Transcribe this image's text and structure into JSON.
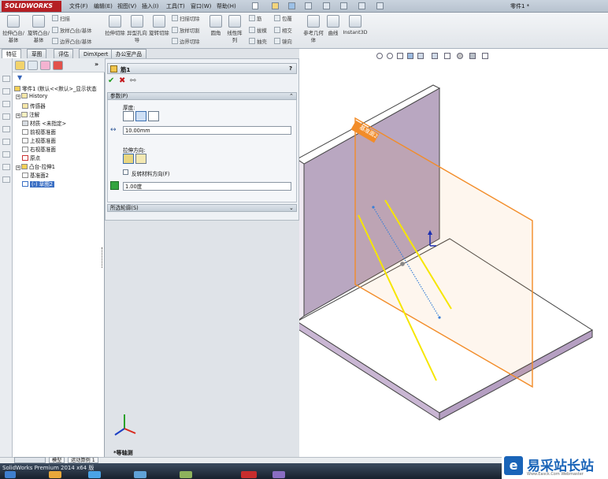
{
  "app": {
    "logo_text": "SOLIDWORKS",
    "doc_title": "零件1 *",
    "menus": [
      "文件(F)",
      "编辑(E)",
      "视图(V)",
      "插入(I)",
      "工具(T)",
      "窗口(W)",
      "帮助(H)"
    ]
  },
  "ribbon": {
    "buttons_large": [
      {
        "label": "拉伸凸台/基体",
        "icon": "extrude-boss-icon"
      },
      {
        "label": "旋转凸台/基体",
        "icon": "revolve-boss-icon"
      },
      {
        "label": "拉伸切除",
        "icon": "extrude-cut-icon"
      },
      {
        "label": "异型孔向导",
        "icon": "hole-wizard-icon"
      },
      {
        "label": "旋转切除",
        "icon": "revolve-cut-icon"
      },
      {
        "label": "圆角",
        "icon": "fillet-icon"
      },
      {
        "label": "线性阵列",
        "icon": "linear-pattern-icon"
      },
      {
        "label": "参考几何体",
        "icon": "reference-geometry-icon"
      },
      {
        "label": "曲线",
        "icon": "curves-icon"
      },
      {
        "label": "Instant3D",
        "icon": "instant3d-icon"
      }
    ],
    "buttons_small": [
      "扫描",
      "放样凸台/基体",
      "边界凸台/基体",
      "扫描切除",
      "放样切割",
      "边界切除",
      "筋",
      "拔模",
      "抽壳",
      "包覆",
      "相交",
      "镜向"
    ]
  },
  "tabs": [
    "特征",
    "草图",
    "评估",
    "DimXpert",
    "办公室产品"
  ],
  "tree": {
    "root": "零件1 (默认<<默认>_显示状态",
    "items": [
      {
        "label": "History",
        "icon": "history-icon",
        "expandable": true
      },
      {
        "label": "传感器",
        "icon": "sensor-icon",
        "expandable": false
      },
      {
        "label": "注解",
        "icon": "annotation-icon",
        "expandable": true
      },
      {
        "label": "材质 <未指定>",
        "icon": "material-icon",
        "expandable": false
      },
      {
        "label": "前视基准面",
        "icon": "plane-icon",
        "expandable": false
      },
      {
        "label": "上视基准面",
        "icon": "plane-icon",
        "expandable": false
      },
      {
        "label": "右视基准面",
        "icon": "plane-icon",
        "expandable": false
      },
      {
        "label": "原点",
        "icon": "origin-icon",
        "expandable": false
      },
      {
        "label": "凸台-拉伸1",
        "icon": "extrude-feature-icon",
        "expandable": true
      },
      {
        "label": "基准面2",
        "icon": "plane-icon",
        "expandable": false
      },
      {
        "label": "(-) 草图2",
        "icon": "sketch-icon",
        "expandable": false,
        "selected": true
      }
    ]
  },
  "pm": {
    "title": "筋1",
    "help": "?",
    "group_params": "参数(P)",
    "thickness_label": "厚度:",
    "thickness_value": "10.00mm",
    "extrude_dir_label": "拉伸方向:",
    "flip_label": "反转材料方向(F)",
    "draft_value": "1.00度",
    "group_contours": "所选轮廓(S)"
  },
  "viewport": {
    "view_label": "*等轴测",
    "plane_label": "基准面2"
  },
  "bottom": {
    "tabs": [
      "模型",
      "运动算例 1"
    ],
    "status": "SolidWorks Premium 2014 x64 版"
  },
  "watermark": {
    "title": "易采站长站",
    "subtitle": "Www.Easck.Com Webmaster"
  },
  "colors": {
    "accent_red": "#b51f24",
    "wall_purple": "#b9a7c1",
    "plane_orange": "#f28c28",
    "rib_yellow": "#f6e600",
    "sketch_blue": "#3b7fd6"
  }
}
